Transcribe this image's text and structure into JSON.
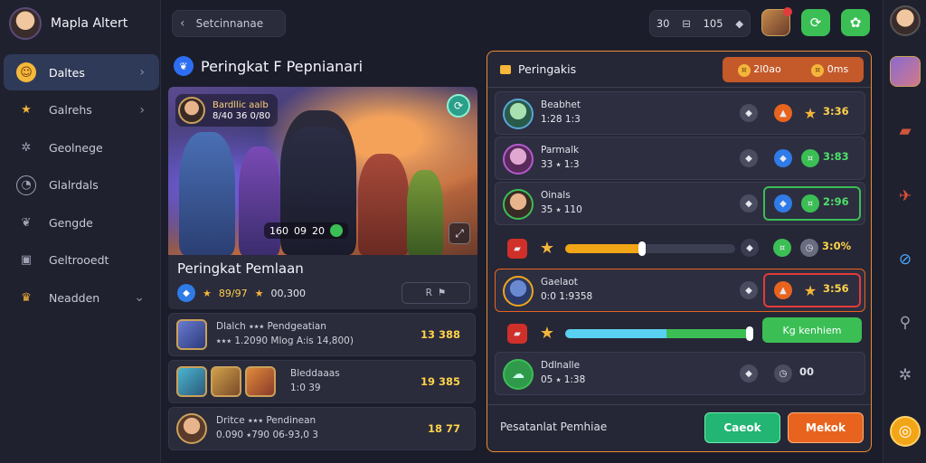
{
  "profile": {
    "name": "Mapla Altert"
  },
  "sidebar": {
    "items": [
      {
        "label": "Daltes",
        "icon": "smile-icon",
        "active": true,
        "chevron": "›"
      },
      {
        "label": "Galrehs",
        "icon": "star-icon",
        "chevron": "›"
      },
      {
        "label": "Geolnege",
        "icon": "settings-icon"
      },
      {
        "label": "Glalrdals",
        "icon": "gauge-icon"
      },
      {
        "label": "Gengde",
        "icon": "leaf-icon"
      },
      {
        "label": "Geltrooedt",
        "icon": "screen-icon"
      },
      {
        "label": "Neadden",
        "icon": "trophy-icon",
        "chevron": "⌄"
      }
    ]
  },
  "topbar": {
    "back_label": "Setcinnanae",
    "stats": [
      "30",
      "105"
    ],
    "colors": {
      "accent": "#ef8a2f",
      "green": "#3bbf55",
      "orange": "#e8641e"
    }
  },
  "left": {
    "section_title": "Peringkat F Pepnianari",
    "hero": {
      "tag_title": "Bardllic aalb",
      "tag_sub": "8/40 36 0/80",
      "score_a": "160",
      "score_b": "09",
      "score_c": "20"
    },
    "card": {
      "title": "Peringkat Pemlaan",
      "stat1": "89/97",
      "stat2": "00,300",
      "pill": "R"
    },
    "rows": [
      {
        "line1": "Dlalch ⭑⭑⭑ Pendgeatian",
        "line2": "⭑⭑⭑ 1.2090    Mlog A:is 14,800)",
        "value": "13 388"
      },
      {
        "line1": "Bleddaaas",
        "line2": "1:0  39 ",
        "value": "19 385"
      },
      {
        "line1": "Dritce ⭑⭑⭑ Pendinean",
        "line2": "0.090  ⭑790  06-93,0 3",
        "value": "18 77"
      }
    ]
  },
  "panel": {
    "title": "Peringakis",
    "tabs": [
      "2l0ao",
      "0ms"
    ],
    "rows": [
      {
        "name": "Beabhet",
        "sub": "1:28  1:3",
        "score": "3:36"
      },
      {
        "name": "Parmalk",
        "sub": "33 ⭑  1:3",
        "score": "3:83"
      },
      {
        "name": "Oinals",
        "sub": "35 ⭑  110",
        "score": "2:96"
      },
      {
        "name": "Gaelaot",
        "sub": "0:0  1:9358",
        "score": "3:56"
      },
      {
        "name": "Ddlnalle",
        "sub": "05 ⭑  1:38",
        "score": "00"
      }
    ],
    "bar1_level": 0.45,
    "bar2_level": 0.98,
    "bar1_right": "3:0%",
    "bar2_button": "Kg kenhiem",
    "footer_label": "Pesatanlat Pemhiae",
    "btn_green": "Caeok",
    "btn_orange": "Mekok"
  }
}
